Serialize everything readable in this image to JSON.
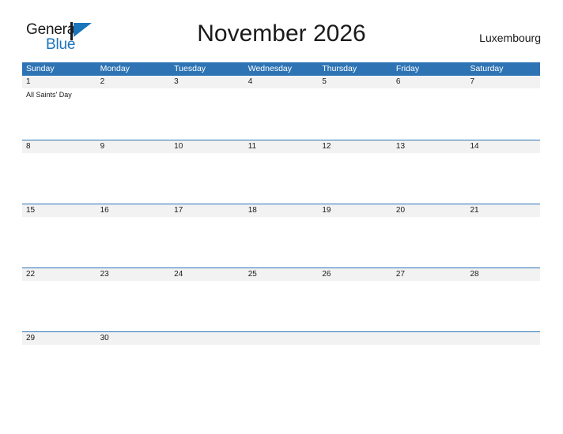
{
  "brand": {
    "name_top": "General",
    "name_bottom": "Blue",
    "flag_icon": "triangle-flag-icon",
    "colors": {
      "blue": "#1b75bb",
      "dark": "#1a1a1a"
    }
  },
  "header": {
    "title": "November 2026",
    "region": "Luxembourg"
  },
  "calendar": {
    "colors": {
      "header_blue": "#2e74b5",
      "date_band_gray": "#f2f2f2",
      "text": "#1a1a1a",
      "header_text": "#ffffff"
    },
    "weekdays": [
      "Sunday",
      "Monday",
      "Tuesday",
      "Wednesday",
      "Thursday",
      "Friday",
      "Saturday"
    ],
    "weeks": [
      [
        {
          "day": "1",
          "events": [
            "All Saints' Day"
          ]
        },
        {
          "day": "2",
          "events": []
        },
        {
          "day": "3",
          "events": []
        },
        {
          "day": "4",
          "events": []
        },
        {
          "day": "5",
          "events": []
        },
        {
          "day": "6",
          "events": []
        },
        {
          "day": "7",
          "events": []
        }
      ],
      [
        {
          "day": "8",
          "events": []
        },
        {
          "day": "9",
          "events": []
        },
        {
          "day": "10",
          "events": []
        },
        {
          "day": "11",
          "events": []
        },
        {
          "day": "12",
          "events": []
        },
        {
          "day": "13",
          "events": []
        },
        {
          "day": "14",
          "events": []
        }
      ],
      [
        {
          "day": "15",
          "events": []
        },
        {
          "day": "16",
          "events": []
        },
        {
          "day": "17",
          "events": []
        },
        {
          "day": "18",
          "events": []
        },
        {
          "day": "19",
          "events": []
        },
        {
          "day": "20",
          "events": []
        },
        {
          "day": "21",
          "events": []
        }
      ],
      [
        {
          "day": "22",
          "events": []
        },
        {
          "day": "23",
          "events": []
        },
        {
          "day": "24",
          "events": []
        },
        {
          "day": "25",
          "events": []
        },
        {
          "day": "26",
          "events": []
        },
        {
          "day": "27",
          "events": []
        },
        {
          "day": "28",
          "events": []
        }
      ],
      [
        {
          "day": "29",
          "events": []
        },
        {
          "day": "30",
          "events": []
        },
        {
          "day": "",
          "events": []
        },
        {
          "day": "",
          "events": []
        },
        {
          "day": "",
          "events": []
        },
        {
          "day": "",
          "events": []
        },
        {
          "day": "",
          "events": []
        }
      ]
    ]
  }
}
